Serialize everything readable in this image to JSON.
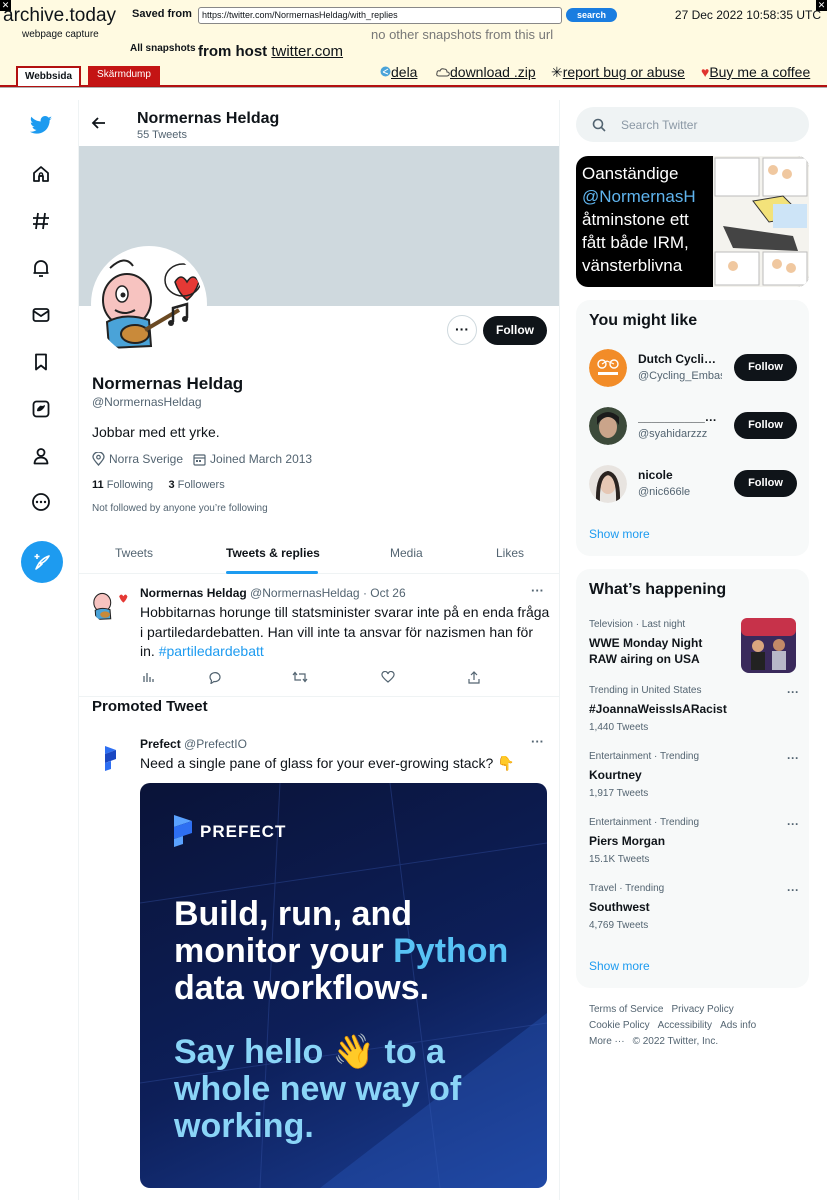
{
  "archive": {
    "logo": "archive.today",
    "logo_sub": "webpage capture",
    "saved_label": "Saved from",
    "url": "https://twitter.com/NormernasHeldag/with_replies",
    "search_label": "search",
    "date": "27 Dec 2022 10:58:35 UTC",
    "all_snapshots": "All snapshots",
    "from_host_label": "from host",
    "host": "twitter.com",
    "no_other": "no other snapshots from this url",
    "tabs": [
      "Webbsida",
      "Skärmdump"
    ],
    "links": {
      "share": "dela",
      "download": "download .zip",
      "report": "report bug or abuse",
      "coffee": "Buy me a coffee"
    }
  },
  "header": {
    "name": "Normernas Heldag",
    "tweet_count": "55 Tweets"
  },
  "profile": {
    "follow_label": "Follow",
    "name": "Normernas Heldag",
    "handle": "@NormernasHeldag",
    "bio": "Jobbar med ett yrke.",
    "location": "Norra Sverige",
    "joined": "Joined March 2013",
    "following_count": "11",
    "following_label": "Following",
    "followers_count": "3",
    "followers_label": "Followers",
    "not_followed": "Not followed by anyone you’re following"
  },
  "tabs": [
    "Tweets",
    "Tweets & replies",
    "Media",
    "Likes"
  ],
  "tweet": {
    "name": "Normernas Heldag",
    "handle": "@NormernasHeldag",
    "sep": "·",
    "date": "Oct 26",
    "text": "Hobbitarnas horunge till statsminister svarar inte på en enda fråga i partiledardebatten. Han vill inte ta ansvar för nazismen han för in.",
    "hashtag": "#partiledardebatt"
  },
  "promoted": {
    "title": "Promoted Tweet",
    "name": "Prefect",
    "handle": "@PrefectIO",
    "text": "Need a single pane of glass for your ever-growing stack? 👇",
    "brand": "PREFECT",
    "line1": "Build, run, and",
    "line2a": "monitor your ",
    "line2b": "Python",
    "line3": "data workflows.",
    "line4": "Say hello 👋 to a",
    "line5": "whole new way of",
    "line6": "working."
  },
  "right": {
    "search_placeholder": "Search Twitter",
    "media_lines": [
      "Oanständige",
      "@NormernasH",
      "åtminstone ett",
      "fått både IRM,",
      "vänsterblivna"
    ],
    "you_might_like": "You might like",
    "suggestions": [
      {
        "name": "Dutch Cycling Embassy",
        "handle": "@Cycling_Embassy",
        "button": "Follow"
      },
      {
        "name": "________________",
        "handle": "@syahidarzzz",
        "button": "Follow"
      },
      {
        "name": "nicole",
        "handle": "@nic666le",
        "button": "Follow"
      }
    ],
    "show_more": "Show more",
    "whats_happening": "What’s happening",
    "trends": [
      {
        "meta": "Television · Last night",
        "title": "WWE Monday Night RAW airing on USA",
        "count": ""
      },
      {
        "meta": "Trending in United States",
        "title": "#JoannaWeissIsARacist",
        "count": "1,440 Tweets"
      },
      {
        "meta": "Entertainment · Trending",
        "title": "Kourtney",
        "count": "1,917 Tweets"
      },
      {
        "meta": "Entertainment · Trending",
        "title": "Piers Morgan",
        "count": "15.1K Tweets"
      },
      {
        "meta": "Travel · Trending",
        "title": "Southwest",
        "count": "4,769 Tweets"
      }
    ],
    "footer": [
      "Terms of Service",
      "Privacy Policy",
      "Cookie Policy",
      "Accessibility",
      "Ads info",
      "More ···",
      "© 2022 Twitter, Inc."
    ]
  }
}
